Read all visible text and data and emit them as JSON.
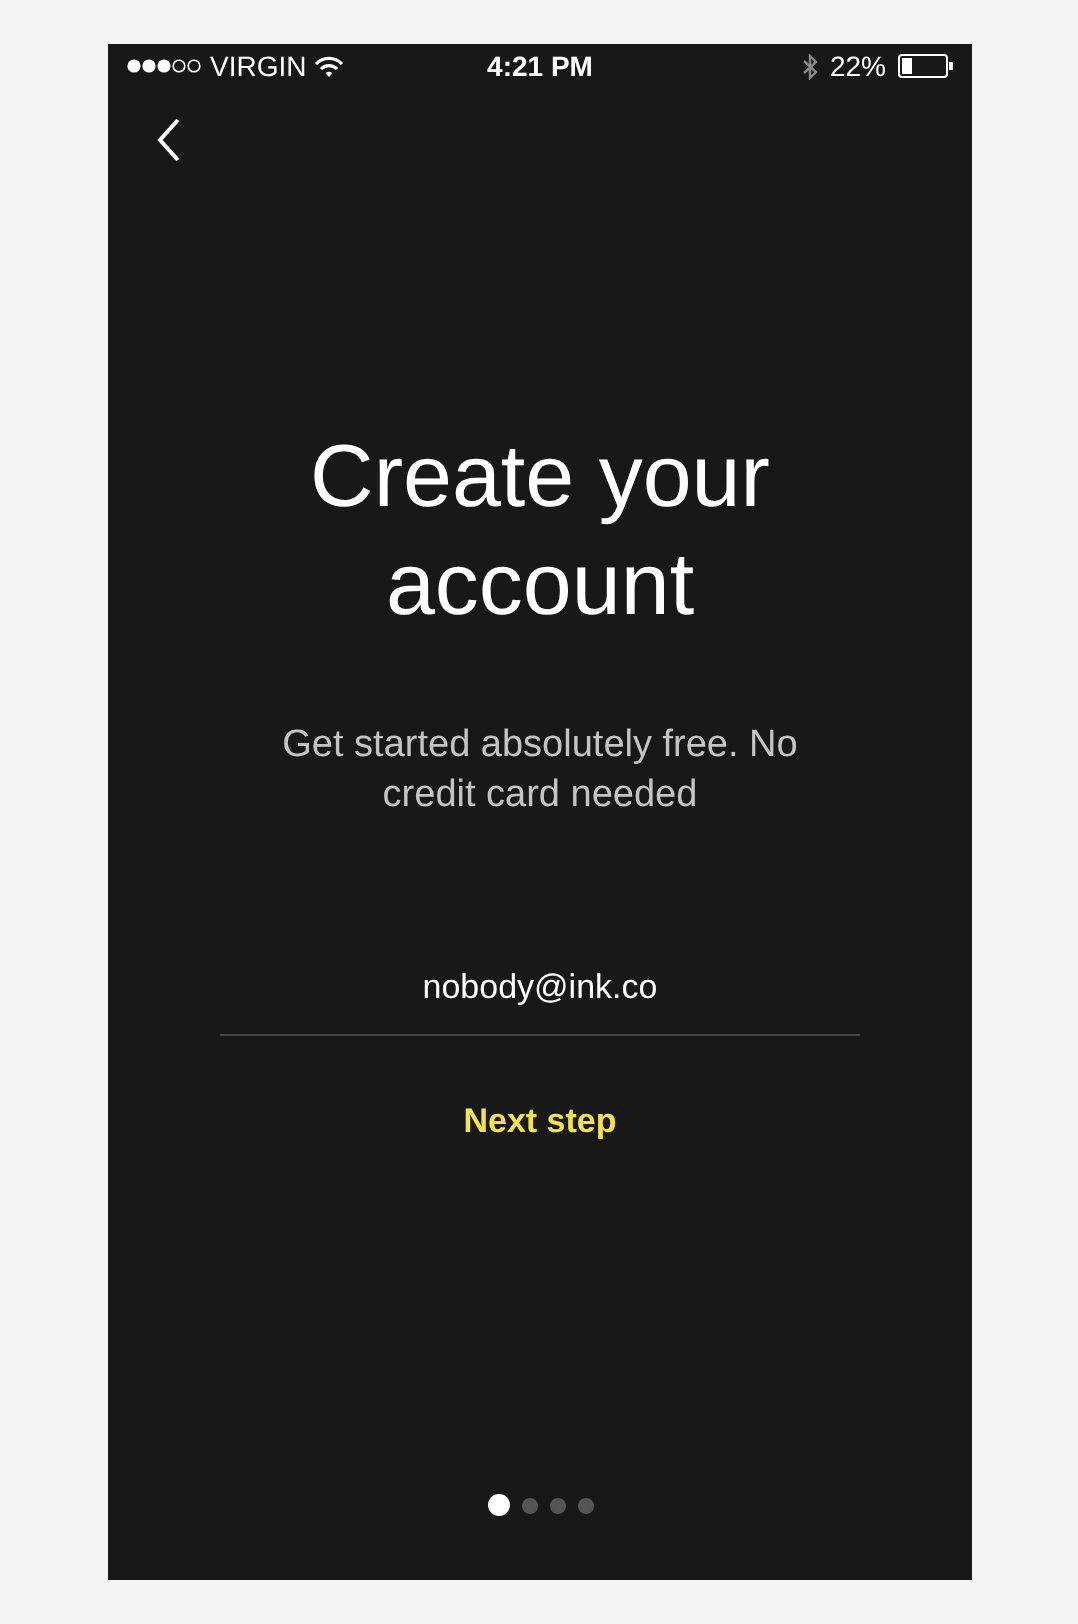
{
  "status_bar": {
    "carrier": "VIRGIN",
    "time": "4:21 PM",
    "battery": "22%"
  },
  "title": "Create your account",
  "subtitle": "Get started absolutely free. No credit card needed",
  "email_field": {
    "value": "nobody@ink.co"
  },
  "next_button": {
    "label": "Next step"
  },
  "page_dots": [
    {
      "selected": true
    },
    {
      "selected": false
    },
    {
      "selected": false
    },
    {
      "selected": false
    }
  ]
}
